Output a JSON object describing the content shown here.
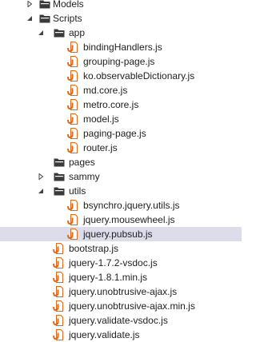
{
  "tree": [
    {
      "label": "Models",
      "icon": "folder-icon",
      "level": 1,
      "expander": "collapsed"
    },
    {
      "label": "Scripts",
      "icon": "folder-icon",
      "level": 1,
      "expander": "expanded"
    },
    {
      "label": "app",
      "icon": "folder-icon",
      "level": 2,
      "expander": "expanded"
    },
    {
      "label": "bindingHandlers.js",
      "icon": "js-file-icon",
      "level": 3,
      "expander": "none"
    },
    {
      "label": "grouping-page.js",
      "icon": "js-file-icon",
      "level": 3,
      "expander": "none"
    },
    {
      "label": "ko.observableDictionary.js",
      "icon": "js-file-icon",
      "level": 3,
      "expander": "none"
    },
    {
      "label": "md.core.js",
      "icon": "js-file-icon",
      "level": 3,
      "expander": "none"
    },
    {
      "label": "metro.core.js",
      "icon": "js-file-icon",
      "level": 3,
      "expander": "none"
    },
    {
      "label": "model.js",
      "icon": "js-file-icon",
      "level": 3,
      "expander": "none"
    },
    {
      "label": "paging-page.js",
      "icon": "js-file-icon",
      "level": 3,
      "expander": "none"
    },
    {
      "label": "router.js",
      "icon": "js-file-icon",
      "level": 3,
      "expander": "none"
    },
    {
      "label": "pages",
      "icon": "folder-icon",
      "level": 2,
      "expander": "none"
    },
    {
      "label": "sammy",
      "icon": "folder-icon",
      "level": 2,
      "expander": "collapsed"
    },
    {
      "label": "utils",
      "icon": "folder-icon",
      "level": 2,
      "expander": "expanded"
    },
    {
      "label": "bsynchro.jquery.utils.js",
      "icon": "js-file-icon",
      "level": 3,
      "expander": "none"
    },
    {
      "label": "jquery.mousewheel.js",
      "icon": "js-file-icon",
      "level": 3,
      "expander": "none"
    },
    {
      "label": "jquery.pubsub.js",
      "icon": "js-file-icon",
      "level": 3,
      "expander": "none",
      "selected": true
    },
    {
      "label": "bootstrap.js",
      "icon": "js-file-icon",
      "level": 2,
      "expander": "none"
    },
    {
      "label": "jquery-1.7.2-vsdoc.js",
      "icon": "js-file-icon",
      "level": 2,
      "expander": "none"
    },
    {
      "label": "jquery-1.8.1.min.js",
      "icon": "js-file-icon",
      "level": 2,
      "expander": "none"
    },
    {
      "label": "jquery.unobtrusive-ajax.js",
      "icon": "js-file-icon",
      "level": 2,
      "expander": "none"
    },
    {
      "label": "jquery.unobtrusive-ajax.min.js",
      "icon": "js-file-icon",
      "level": 2,
      "expander": "none"
    },
    {
      "label": "jquery.validate-vsdoc.js",
      "icon": "js-file-icon",
      "level": 2,
      "expander": "none"
    },
    {
      "label": "jquery.validate.js",
      "icon": "js-file-icon",
      "level": 2,
      "expander": "none"
    }
  ],
  "colors": {
    "selection": "#dcdcea",
    "folder_fill": "#3a3a3a",
    "js_file": "#d96a1e",
    "arrow": "#444444",
    "text": "#1e1e1e"
  }
}
